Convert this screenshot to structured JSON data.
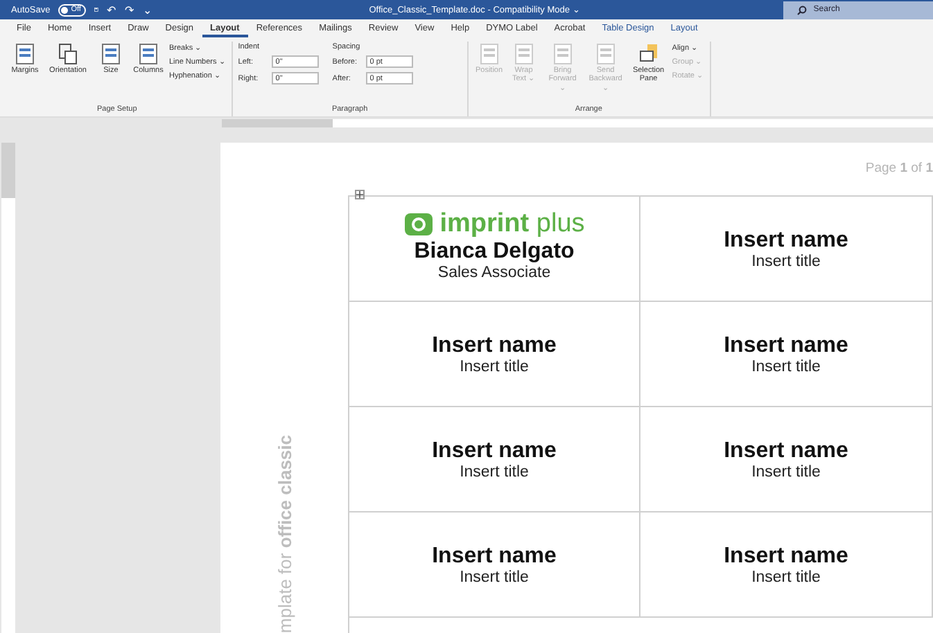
{
  "title_bar": {
    "autosave_label": "AutoSave",
    "autosave_toggle": {
      "label": "Off",
      "on": false
    },
    "quick_access": [
      "↶",
      "↷",
      "⌄"
    ],
    "title": "Office_Classic_Template.doc  -  Compatibility Mode  ⌄",
    "search": {
      "placeholder": "Search"
    }
  },
  "tabs": [
    {
      "label": "File",
      "selected": false,
      "contextual": false
    },
    {
      "label": "Home",
      "selected": false,
      "contextual": false
    },
    {
      "label": "Insert",
      "selected": false,
      "contextual": false
    },
    {
      "label": "Draw",
      "selected": false,
      "contextual": false
    },
    {
      "label": "Design",
      "selected": false,
      "contextual": false
    },
    {
      "label": "Layout",
      "selected": true,
      "contextual": false
    },
    {
      "label": "References",
      "selected": false,
      "contextual": false
    },
    {
      "label": "Mailings",
      "selected": false,
      "contextual": false
    },
    {
      "label": "Review",
      "selected": false,
      "contextual": false
    },
    {
      "label": "View",
      "selected": false,
      "contextual": false
    },
    {
      "label": "Help",
      "selected": false,
      "contextual": false
    },
    {
      "label": "DYMO Label",
      "selected": false,
      "contextual": false
    },
    {
      "label": "Acrobat",
      "selected": false,
      "contextual": false
    },
    {
      "label": "Table Design",
      "selected": false,
      "contextual": true
    },
    {
      "label": "Layout",
      "selected": false,
      "contextual": true
    }
  ],
  "ribbon": {
    "page_setup": {
      "label": "Page Setup",
      "big_buttons": [
        {
          "label": "Margins"
        },
        {
          "label": "Orientation"
        },
        {
          "label": "Size"
        },
        {
          "label": "Columns"
        }
      ],
      "small_buttons": [
        "Breaks ⌄",
        "Line Numbers ⌄",
        "Hyphenation ⌄"
      ]
    },
    "paragraph": {
      "label": "Paragraph",
      "indent_label": "Indent",
      "spacing_label": "Spacing",
      "fields": [
        {
          "label": "Left:",
          "value": "0\""
        },
        {
          "label": "Right:",
          "value": "0\""
        },
        {
          "label": "Before:",
          "value": "0 pt"
        },
        {
          "label": "After:",
          "value": "0 pt"
        }
      ]
    },
    "arrange": {
      "label": "Arrange",
      "big_buttons": [
        {
          "label": "Position",
          "disabled": true
        },
        {
          "label": "Wrap Text ⌄",
          "disabled": true
        },
        {
          "label": "Bring Forward ⌄",
          "disabled": true
        },
        {
          "label": "Send Backward ⌄",
          "disabled": true
        },
        {
          "label": "Selection Pane",
          "disabled": false
        }
      ],
      "small_buttons": [
        {
          "label": "Align ⌄",
          "disabled": false
        },
        {
          "label": "Group ⌄",
          "disabled": true
        },
        {
          "label": "Rotate ⌄",
          "disabled": true
        }
      ]
    }
  },
  "document": {
    "page_number": "Page **1** of **1**",
    "side_text": "mplate for **office classic**",
    "labels": [
      {
        "kind": "logo",
        "brand": "imprint",
        "brand_suffix": "plus",
        "name": "Bianca Delgato",
        "title": "Sales Associate"
      },
      {
        "kind": "text",
        "name": "Insert name",
        "title": "Insert title"
      },
      {
        "kind": "text",
        "name": "Insert name",
        "title": "Insert title"
      },
      {
        "kind": "text",
        "name": "Insert name",
        "title": "Insert title"
      },
      {
        "kind": "text",
        "name": "Insert name",
        "title": "Insert title"
      },
      {
        "kind": "text",
        "name": "Insert name",
        "title": "Insert title"
      },
      {
        "kind": "text",
        "name": "Insert name",
        "title": "Insert title"
      },
      {
        "kind": "text",
        "name": "Insert name",
        "title": "Insert title"
      }
    ]
  }
}
